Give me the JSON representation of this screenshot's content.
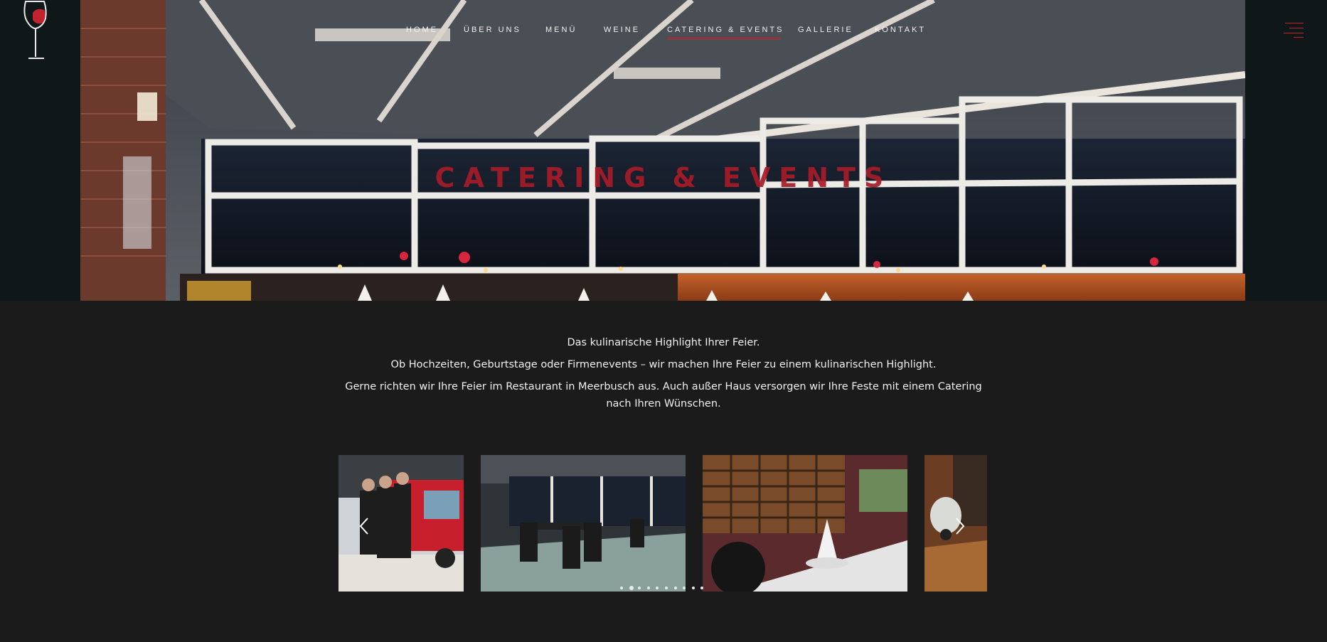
{
  "nav": {
    "items": [
      {
        "label": "HOME",
        "active": false
      },
      {
        "label": "ÜBER UNS",
        "active": false
      },
      {
        "label": "MENÜ",
        "active": false
      },
      {
        "label": "WEINE",
        "active": false
      },
      {
        "label": "CATERING & EVENTS",
        "active": true
      },
      {
        "label": "GALLERIE",
        "active": false
      },
      {
        "label": "KONTAKT",
        "active": false
      }
    ]
  },
  "hero": {
    "title": "CATERING & EVENTS"
  },
  "intro": {
    "line1": "Das kulinarische Highlight Ihrer Feier.",
    "line2": "Ob Hochzeiten, Geburtstage oder Firmenevents – wir machen Ihre Feier zu einem kulinarischen Highlight.",
    "line3": "Gerne richten wir Ihre Feier im Restaurant in Meerbusch aus. Auch außer Haus versorgen wir Ihre Feste mit einem Catering nach Ihren Wünschen."
  },
  "slider": {
    "slide_count": 10,
    "active_index": 1
  },
  "colors": {
    "accent": "#c1242f",
    "title": "#a81b29",
    "background": "#1b1b1b",
    "header_bg": "#0f1718",
    "text": "#f0f0f0"
  },
  "icons": {
    "logo": "wine-glass-logo",
    "menu": "hamburger-menu-icon",
    "prev": "chevron-left-icon",
    "next": "chevron-right-icon"
  }
}
